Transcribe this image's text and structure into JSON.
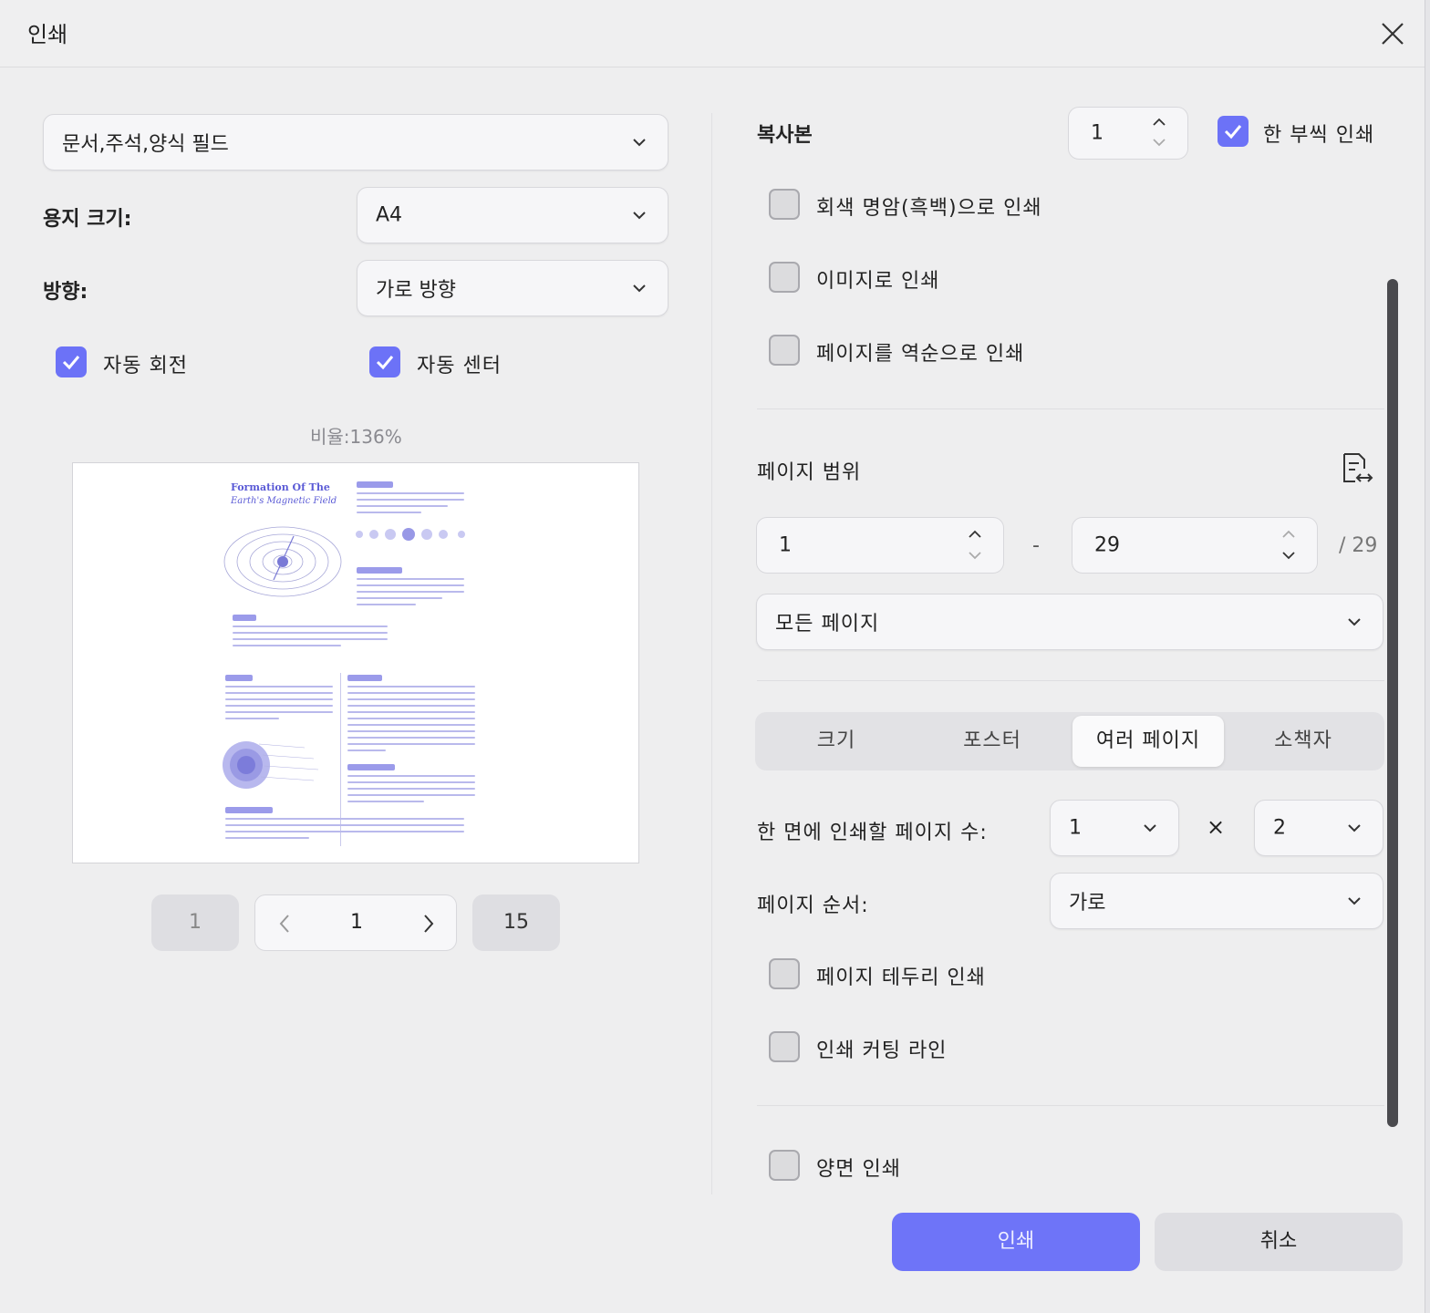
{
  "window": {
    "title": "인쇄"
  },
  "left": {
    "content_select": "문서,주석,양식 필드",
    "paper_size_label": "용지 크기:",
    "paper_size_value": "A4",
    "orientation_label": "방향:",
    "orientation_value": "가로 방향",
    "auto_rotate": {
      "label": "자동 회전",
      "checked": true
    },
    "auto_center": {
      "label": "자동 센터",
      "checked": true
    },
    "ratio": "비율:136%",
    "preview": {
      "title_line1": "Formation Of The",
      "title_line2": "Earth's Magnetic Field"
    },
    "pager": {
      "first": "1",
      "current": "1",
      "last": "15"
    }
  },
  "right": {
    "copies_label": "복사본",
    "copies_value": "1",
    "collate": {
      "label": "한 부씩 인쇄",
      "checked": true
    },
    "grayscale": {
      "label": "회색 명암(흑백)으로 인쇄",
      "checked": false
    },
    "as_image": {
      "label": "이미지로 인쇄",
      "checked": false
    },
    "reverse": {
      "label": "페이지를 역순으로 인쇄",
      "checked": false
    },
    "range_label": "페이지 범위",
    "range_from": "1",
    "range_to": "29",
    "range_total": "/ 29",
    "range_dash": "-",
    "range_subset": "모든 페이지",
    "tabs": [
      "크기",
      "포스터",
      "여러 페이지",
      "소책자"
    ],
    "active_tab": "여러 페이지",
    "pages_per_sheet_label": "한 면에 인쇄할 페이지 수:",
    "pages_per_sheet_cols": "1",
    "pages_per_sheet_x": "×",
    "pages_per_sheet_rows": "2",
    "page_order_label": "페이지 순서:",
    "page_order_value": "가로",
    "page_border": {
      "label": "페이지 테두리 인쇄",
      "checked": false
    },
    "cut_lines": {
      "label": "인쇄 커팅 라인",
      "checked": false
    },
    "duplex": {
      "label": "양면 인쇄",
      "checked": false
    }
  },
  "footer": {
    "print_label": "인쇄",
    "cancel_label": "취소"
  },
  "colors": {
    "accent": "#6c72f7"
  }
}
